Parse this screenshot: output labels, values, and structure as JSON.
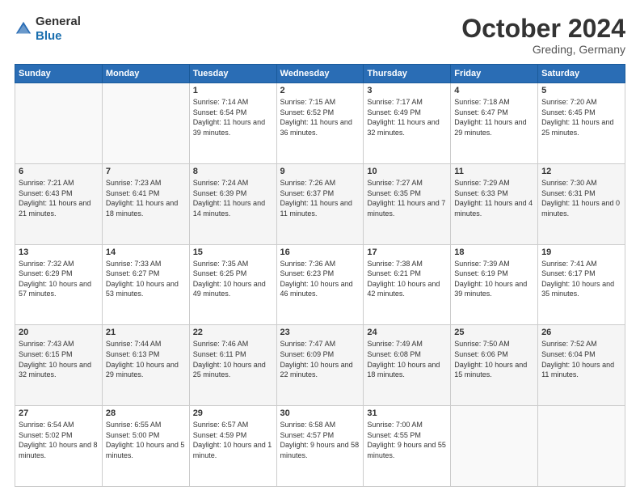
{
  "header": {
    "logo_general": "General",
    "logo_blue": "Blue",
    "month": "October 2024",
    "location": "Greding, Germany"
  },
  "days_of_week": [
    "Sunday",
    "Monday",
    "Tuesday",
    "Wednesday",
    "Thursday",
    "Friday",
    "Saturday"
  ],
  "weeks": [
    [
      {
        "day": "",
        "info": ""
      },
      {
        "day": "",
        "info": ""
      },
      {
        "day": "1",
        "info": "Sunrise: 7:14 AM\nSunset: 6:54 PM\nDaylight: 11 hours and 39 minutes."
      },
      {
        "day": "2",
        "info": "Sunrise: 7:15 AM\nSunset: 6:52 PM\nDaylight: 11 hours and 36 minutes."
      },
      {
        "day": "3",
        "info": "Sunrise: 7:17 AM\nSunset: 6:49 PM\nDaylight: 11 hours and 32 minutes."
      },
      {
        "day": "4",
        "info": "Sunrise: 7:18 AM\nSunset: 6:47 PM\nDaylight: 11 hours and 29 minutes."
      },
      {
        "day": "5",
        "info": "Sunrise: 7:20 AM\nSunset: 6:45 PM\nDaylight: 11 hours and 25 minutes."
      }
    ],
    [
      {
        "day": "6",
        "info": "Sunrise: 7:21 AM\nSunset: 6:43 PM\nDaylight: 11 hours and 21 minutes."
      },
      {
        "day": "7",
        "info": "Sunrise: 7:23 AM\nSunset: 6:41 PM\nDaylight: 11 hours and 18 minutes."
      },
      {
        "day": "8",
        "info": "Sunrise: 7:24 AM\nSunset: 6:39 PM\nDaylight: 11 hours and 14 minutes."
      },
      {
        "day": "9",
        "info": "Sunrise: 7:26 AM\nSunset: 6:37 PM\nDaylight: 11 hours and 11 minutes."
      },
      {
        "day": "10",
        "info": "Sunrise: 7:27 AM\nSunset: 6:35 PM\nDaylight: 11 hours and 7 minutes."
      },
      {
        "day": "11",
        "info": "Sunrise: 7:29 AM\nSunset: 6:33 PM\nDaylight: 11 hours and 4 minutes."
      },
      {
        "day": "12",
        "info": "Sunrise: 7:30 AM\nSunset: 6:31 PM\nDaylight: 11 hours and 0 minutes."
      }
    ],
    [
      {
        "day": "13",
        "info": "Sunrise: 7:32 AM\nSunset: 6:29 PM\nDaylight: 10 hours and 57 minutes."
      },
      {
        "day": "14",
        "info": "Sunrise: 7:33 AM\nSunset: 6:27 PM\nDaylight: 10 hours and 53 minutes."
      },
      {
        "day": "15",
        "info": "Sunrise: 7:35 AM\nSunset: 6:25 PM\nDaylight: 10 hours and 49 minutes."
      },
      {
        "day": "16",
        "info": "Sunrise: 7:36 AM\nSunset: 6:23 PM\nDaylight: 10 hours and 46 minutes."
      },
      {
        "day": "17",
        "info": "Sunrise: 7:38 AM\nSunset: 6:21 PM\nDaylight: 10 hours and 42 minutes."
      },
      {
        "day": "18",
        "info": "Sunrise: 7:39 AM\nSunset: 6:19 PM\nDaylight: 10 hours and 39 minutes."
      },
      {
        "day": "19",
        "info": "Sunrise: 7:41 AM\nSunset: 6:17 PM\nDaylight: 10 hours and 35 minutes."
      }
    ],
    [
      {
        "day": "20",
        "info": "Sunrise: 7:43 AM\nSunset: 6:15 PM\nDaylight: 10 hours and 32 minutes."
      },
      {
        "day": "21",
        "info": "Sunrise: 7:44 AM\nSunset: 6:13 PM\nDaylight: 10 hours and 29 minutes."
      },
      {
        "day": "22",
        "info": "Sunrise: 7:46 AM\nSunset: 6:11 PM\nDaylight: 10 hours and 25 minutes."
      },
      {
        "day": "23",
        "info": "Sunrise: 7:47 AM\nSunset: 6:09 PM\nDaylight: 10 hours and 22 minutes."
      },
      {
        "day": "24",
        "info": "Sunrise: 7:49 AM\nSunset: 6:08 PM\nDaylight: 10 hours and 18 minutes."
      },
      {
        "day": "25",
        "info": "Sunrise: 7:50 AM\nSunset: 6:06 PM\nDaylight: 10 hours and 15 minutes."
      },
      {
        "day": "26",
        "info": "Sunrise: 7:52 AM\nSunset: 6:04 PM\nDaylight: 10 hours and 11 minutes."
      }
    ],
    [
      {
        "day": "27",
        "info": "Sunrise: 6:54 AM\nSunset: 5:02 PM\nDaylight: 10 hours and 8 minutes."
      },
      {
        "day": "28",
        "info": "Sunrise: 6:55 AM\nSunset: 5:00 PM\nDaylight: 10 hours and 5 minutes."
      },
      {
        "day": "29",
        "info": "Sunrise: 6:57 AM\nSunset: 4:59 PM\nDaylight: 10 hours and 1 minute."
      },
      {
        "day": "30",
        "info": "Sunrise: 6:58 AM\nSunset: 4:57 PM\nDaylight: 9 hours and 58 minutes."
      },
      {
        "day": "31",
        "info": "Sunrise: 7:00 AM\nSunset: 4:55 PM\nDaylight: 9 hours and 55 minutes."
      },
      {
        "day": "",
        "info": ""
      },
      {
        "day": "",
        "info": ""
      }
    ]
  ]
}
